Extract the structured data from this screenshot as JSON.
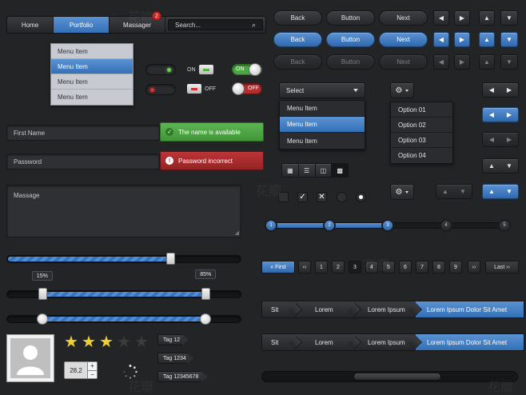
{
  "nav": {
    "items": [
      {
        "label": "Home"
      },
      {
        "label": "Portfolio"
      },
      {
        "label": "Massager",
        "badge": "2"
      }
    ],
    "search_placeholder": "Search..."
  },
  "portfolio_menu": [
    "Menu Item",
    "Menu Item",
    "Menu Item",
    "Menu Item"
  ],
  "toggles": {
    "on_label": "ON",
    "off_label": "OFF",
    "on_label_green": "ON",
    "off_label_red": "OFF"
  },
  "form": {
    "first_name_placeholder": "First Name",
    "first_name_msg": "The name is available",
    "password_placeholder": "Password",
    "password_msg": "Password incorrect",
    "message_placeholder": "Massage"
  },
  "sliders": {
    "single_value": 0.7,
    "range_low_label": "15%",
    "range_high_label": "85%",
    "range_low": 0.15,
    "range_high": 0.85,
    "range2_low": 0.15,
    "range2_high": 0.85
  },
  "rating": {
    "value": 3,
    "max": 5
  },
  "spinner": {
    "value": "28,2",
    "plus": "+",
    "minus": "−"
  },
  "tags": [
    "Tag 12",
    "Tag 1234",
    "Tag 12345678"
  ],
  "buttons": {
    "row1": [
      "Back",
      "Button",
      "Next"
    ],
    "row2": [
      "Back",
      "Button",
      "Next"
    ],
    "row3": [
      "Back",
      "Button",
      "Next"
    ]
  },
  "select": {
    "label": "Select",
    "items": [
      "Menu Item",
      "Menu Item",
      "Menu Item"
    ]
  },
  "gear_menu": [
    "Option 01",
    "Option 02",
    "Option 03",
    "Option 04"
  ],
  "steps": [
    "1",
    "2",
    "3",
    "4",
    "5"
  ],
  "steps_progress": 0.5,
  "pagination": {
    "first": "« First",
    "prev": "‹‹",
    "pages": [
      "1",
      "2",
      "3",
      "4",
      "5",
      "6",
      "7",
      "8",
      "9"
    ],
    "next": "››",
    "last": "Last ››"
  },
  "breadcrumbs": [
    "Sit",
    "Lorem",
    "Lorem Ipsum",
    "Lorem Ipsum Dolor Sit Amet"
  ],
  "watermark": "花瓣",
  "colors": {
    "accent": "#4a86cc",
    "success": "#4fa646",
    "error": "#b52d2f",
    "background": "#232426"
  }
}
